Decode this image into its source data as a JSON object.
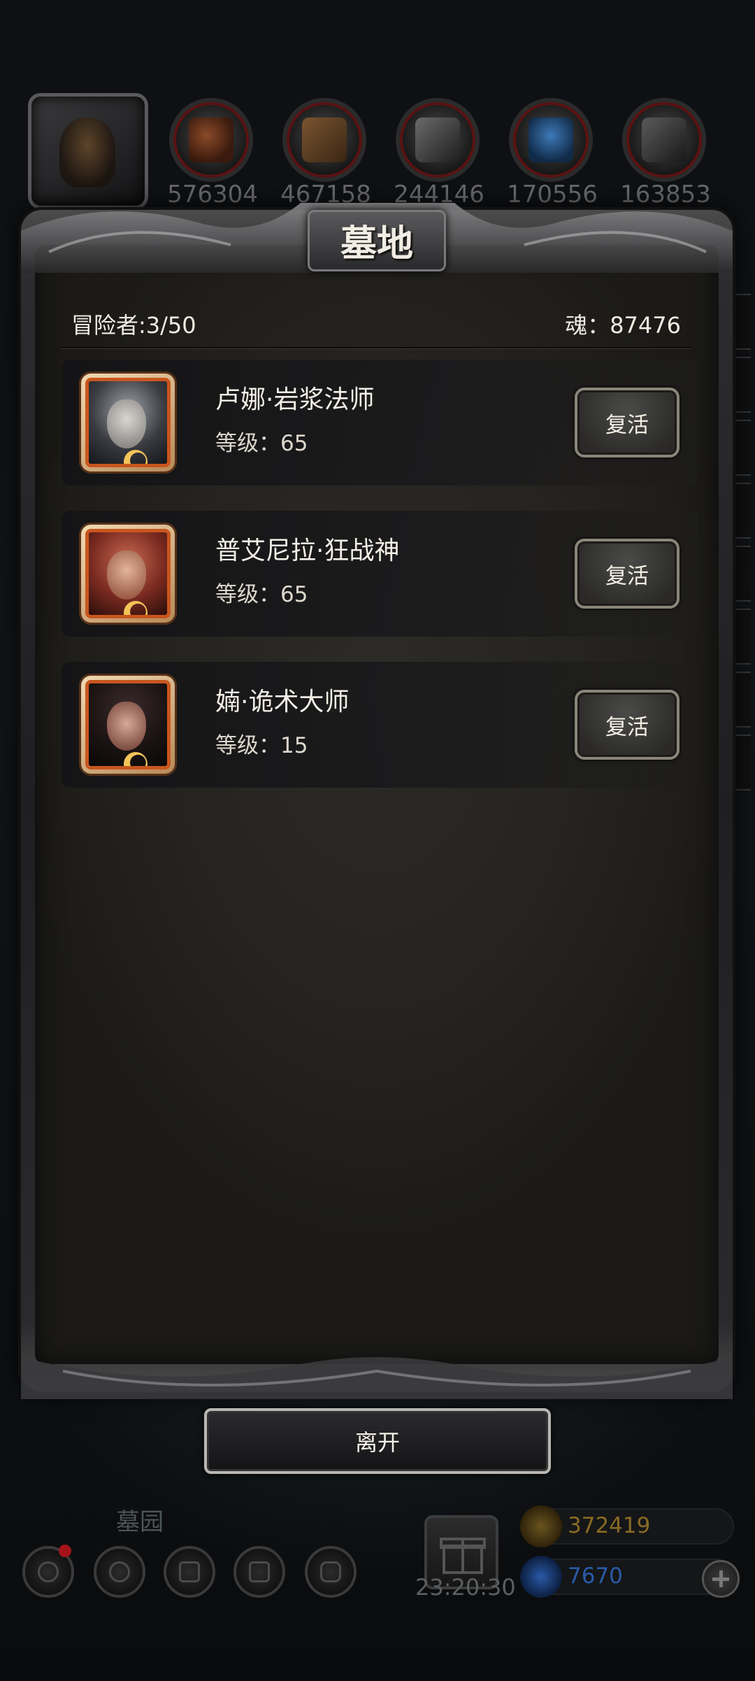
{
  "dialog": {
    "title": "墓地",
    "adventurers_label": "冒险者:3/50",
    "soul_label": "魂：87476",
    "revive_label": "复活",
    "leave_label": "离开"
  },
  "heroes": [
    {
      "name": "卢娜·岩浆法师",
      "level": "等级：65"
    },
    {
      "name": "普艾尼拉·狂战神",
      "level": "等级：65"
    },
    {
      "name": "婻·诡术大师",
      "level": "等级：15"
    }
  ],
  "resources": [
    {
      "icon": "meat-icon",
      "value": "576304"
    },
    {
      "icon": "wood-icon",
      "value": "467158"
    },
    {
      "icon": "stone-icon",
      "value": "244146"
    },
    {
      "icon": "crystal-icon",
      "value": "170556"
    },
    {
      "icon": "iron-icon",
      "value": "163853"
    }
  ],
  "hud": {
    "location": "墓园",
    "timer": "23:20:30",
    "gold": "372419",
    "gems": "7670"
  },
  "colors": {
    "panel_bg": "#25231f",
    "frame_accent": "#8a857a",
    "avatar_border": "#c8561e",
    "gold_text": "#8a6a24",
    "gem_text": "#2a5aa8"
  }
}
